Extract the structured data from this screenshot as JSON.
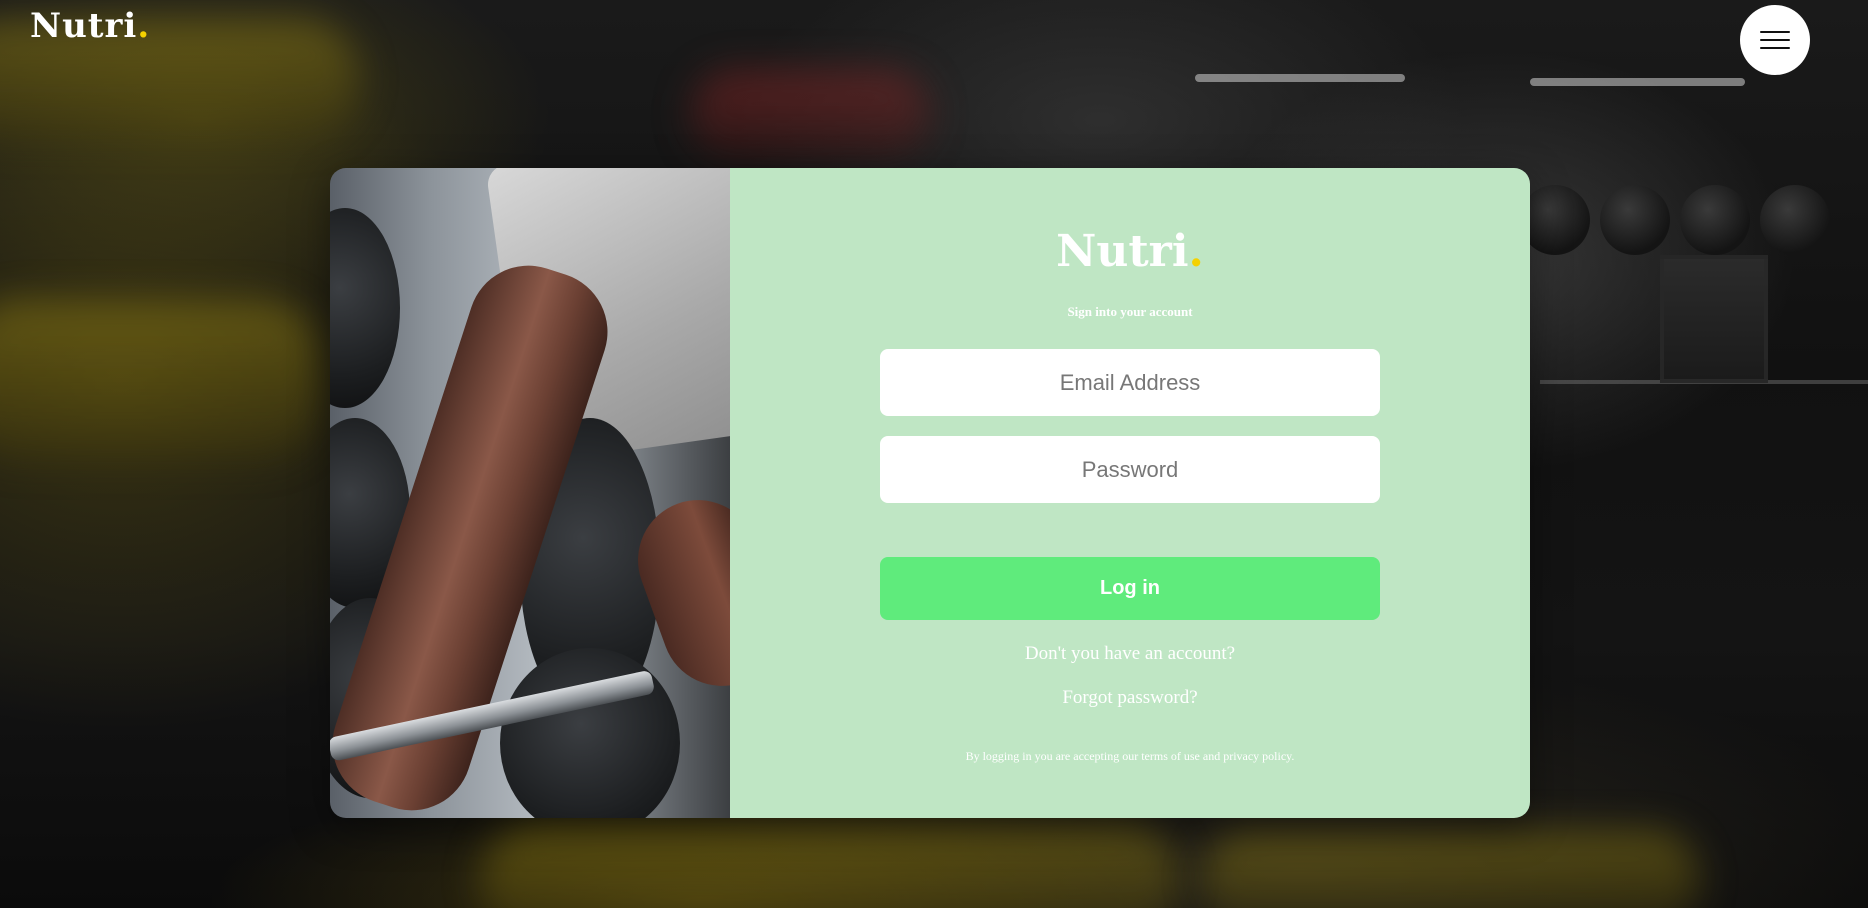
{
  "header": {
    "brand_name": "Nutri",
    "brand_dot": ".",
    "menu_icon": "hamburger-menu-icon"
  },
  "colors": {
    "form_background": "#bfe6c4",
    "login_button": "#5feb7c",
    "brand_dot": "#f5d100",
    "text": "#ffffff"
  },
  "login_card": {
    "brand_name": "Nutri",
    "brand_dot": ".",
    "subtitle": "Sign into your account",
    "email_placeholder": "Email Address",
    "password_placeholder": "Password",
    "login_label": "Log in",
    "signup_link": "Don't you have an account?",
    "forgot_link": "Forgot password?",
    "terms_text": "By logging in you are accepting our terms of use and privacy policy."
  }
}
